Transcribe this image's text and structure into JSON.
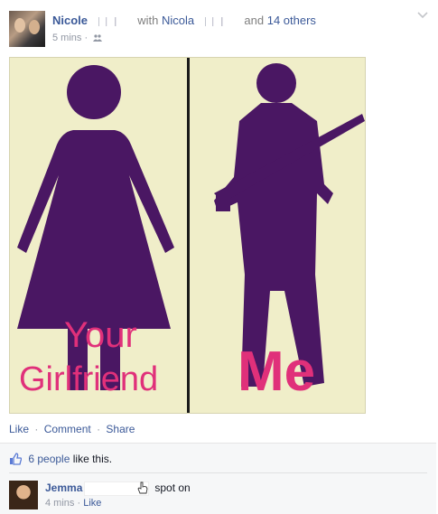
{
  "post": {
    "author": "Nicole",
    "with_label": "with",
    "tagged": "Nicola",
    "and_label": "and",
    "others": "14 others",
    "time": "5 mins",
    "time_sep": "·"
  },
  "photo": {
    "left_caption_line1": "Your",
    "left_caption_line2": "Girlfriend",
    "right_caption": "Me",
    "colors": {
      "background": "#f0eec9",
      "silhouette": "#4a1763",
      "caption": "#e0307a"
    }
  },
  "actions": {
    "like": "Like",
    "comment": "Comment",
    "share": "Share",
    "sep": "·"
  },
  "ufi": {
    "likes_people": "6 people",
    "likes_suffix": "like this.",
    "comment": {
      "author": "Jemma",
      "text": "spot on",
      "time": "4 mins",
      "sep": "·",
      "like": "Like"
    }
  },
  "accent": "#3b5998"
}
